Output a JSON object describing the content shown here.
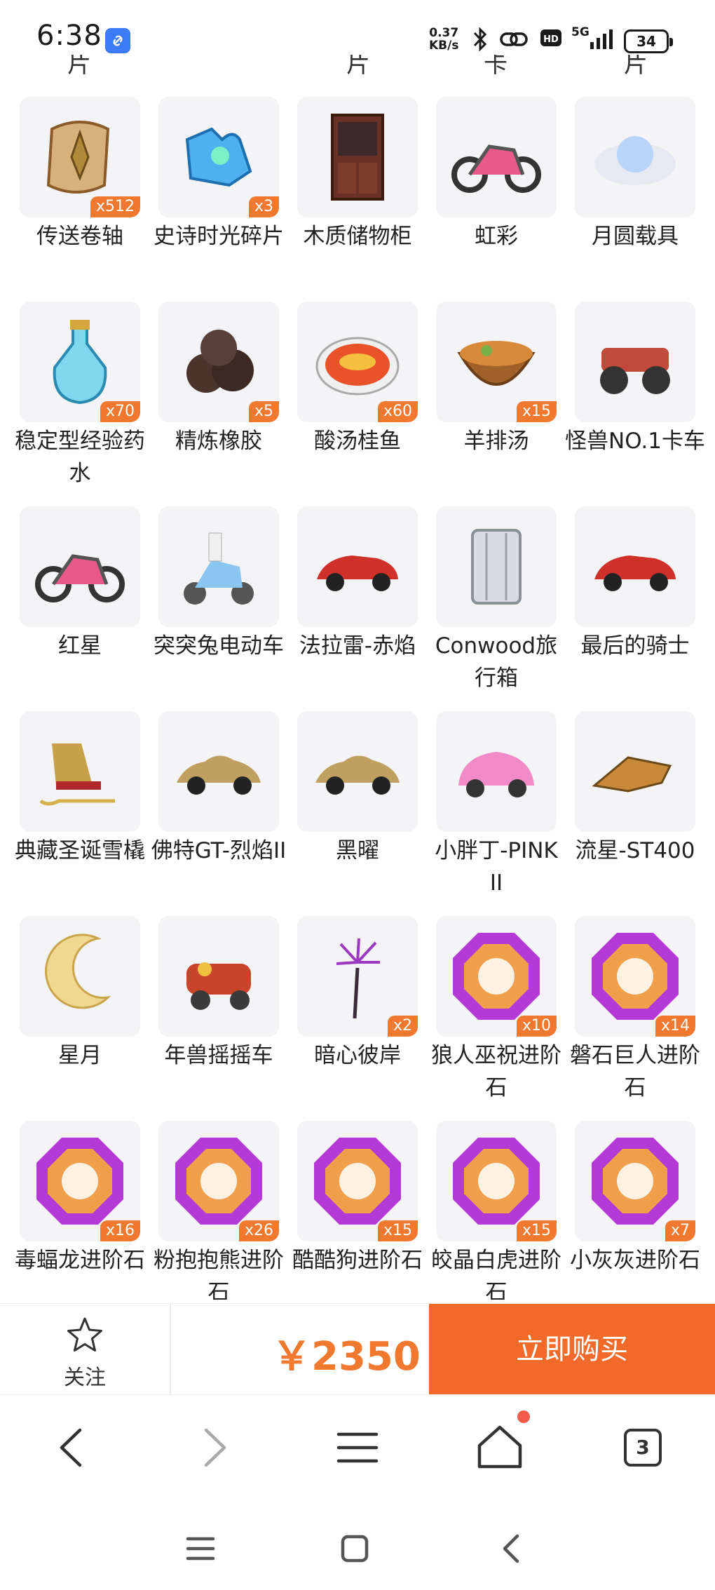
{
  "status_bar": {
    "time": "6:38",
    "network_speed_value": "0.37",
    "network_speed_unit": "KB/s",
    "network_type": "5G",
    "battery": "34"
  },
  "partial_row": [
    "片",
    "片",
    "卡",
    "片"
  ],
  "items": [
    {
      "name": "传送卷轴",
      "count": "x512",
      "icon": "scroll-icon"
    },
    {
      "name": "史诗时光碎片",
      "count": "x3",
      "icon": "puzzle-fragment-icon"
    },
    {
      "name": "木质储物柜",
      "count": "",
      "icon": "cabinet-icon"
    },
    {
      "name": "虹彩",
      "count": "",
      "icon": "motorcycle-icon"
    },
    {
      "name": "月圆载具",
      "count": "",
      "icon": "moon-cloud-icon"
    },
    {
      "name": "稳定型经验药水",
      "count": "x70",
      "icon": "potion-icon"
    },
    {
      "name": "精炼橡胶",
      "count": "x5",
      "icon": "rubber-icon"
    },
    {
      "name": "酸汤桂鱼",
      "count": "x60",
      "icon": "fish-soup-icon"
    },
    {
      "name": "羊排汤",
      "count": "x15",
      "icon": "soup-bowl-icon"
    },
    {
      "name": "怪兽NO.1卡车",
      "count": "",
      "icon": "monster-truck-icon"
    },
    {
      "name": "红星",
      "count": "",
      "icon": "motorcycle-icon"
    },
    {
      "name": "突突兔电动车",
      "count": "",
      "icon": "scooter-icon"
    },
    {
      "name": "法拉雷-赤焰",
      "count": "",
      "icon": "sports-car-icon"
    },
    {
      "name": "Conwood旅行箱",
      "count": "",
      "icon": "suitcase-icon"
    },
    {
      "name": "最后的骑士",
      "count": "",
      "icon": "sports-car-icon"
    },
    {
      "name": "典藏圣诞雪橇",
      "count": "",
      "icon": "sleigh-icon"
    },
    {
      "name": "佛特GT-烈焰II",
      "count": "",
      "icon": "classic-car-icon"
    },
    {
      "name": "黑曜",
      "count": "",
      "icon": "classic-car-icon"
    },
    {
      "name": "小胖丁-PINK II",
      "count": "",
      "icon": "beetle-car-icon"
    },
    {
      "name": "流星-ST400",
      "count": "",
      "icon": "hover-bike-icon"
    },
    {
      "name": "星月",
      "count": "",
      "icon": "crescent-moon-icon"
    },
    {
      "name": "年兽摇摇车",
      "count": "",
      "icon": "dragon-cart-icon"
    },
    {
      "name": "暗心彼岸",
      "count": "x2",
      "icon": "flower-icon"
    },
    {
      "name": "狼人巫祝进阶石",
      "count": "x10",
      "icon": "gem-icon"
    },
    {
      "name": "磐石巨人进阶石",
      "count": "x14",
      "icon": "gem-icon"
    },
    {
      "name": "毒蝠龙进阶石",
      "count": "x16",
      "icon": "gem-icon"
    },
    {
      "name": "粉抱抱熊进阶石",
      "count": "x26",
      "icon": "gem-icon"
    },
    {
      "name": "酷酷狗进阶石",
      "count": "x15",
      "icon": "gem-icon"
    },
    {
      "name": "皎晶白虎进阶石",
      "count": "x15",
      "icon": "gem-icon"
    },
    {
      "name": "小灰灰进阶石",
      "count": "x7",
      "icon": "gem-icon"
    }
  ],
  "action_bar": {
    "follow_label": "关注",
    "price": "￥2350",
    "buy_label": "立即购买"
  },
  "browser_bar": {
    "tab_count": "3"
  },
  "colors": {
    "accent": "#f26a2a",
    "badge": "#f0792f",
    "price": "#f0792f"
  }
}
